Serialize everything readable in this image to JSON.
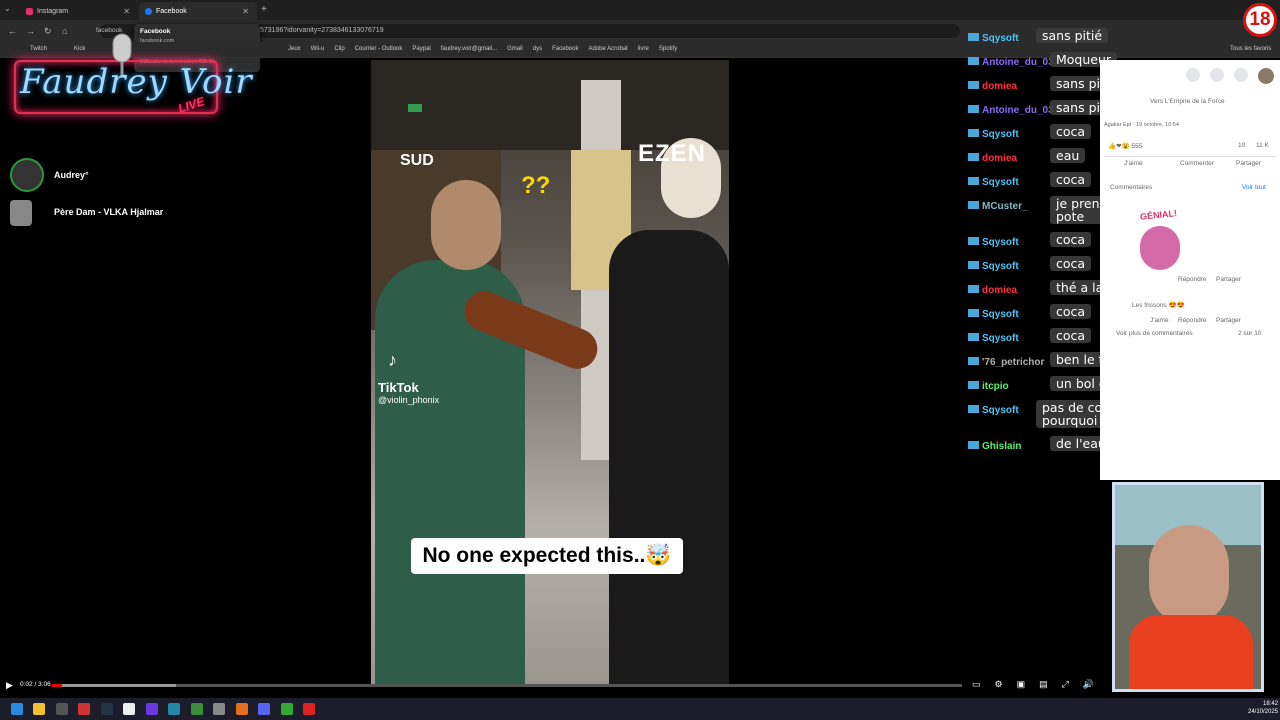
{
  "browser": {
    "tabs": [
      {
        "label": "Instagram"
      },
      {
        "label": "Facebook"
      }
    ],
    "tooltip_title": "Facebook",
    "tooltip_domain": "facebook.com",
    "tooltip_memory": "Utilisation de la mémoire : 731 Mo",
    "url_fragment": "facebook",
    "url": "573196?idorvanity=2738346133076719",
    "bookmarks": [
      "Twitch",
      "Kick",
      "Jeux",
      "Wii-u",
      "Clip",
      "Courrier - Outlook",
      "Paypal",
      "faudrey.voir@gmail...",
      "Gmail",
      "dys",
      "Facebook",
      "Adobe Acrobat",
      "livre",
      "Spotify"
    ],
    "all_bookmarks": "Tous les favoris"
  },
  "overlay": {
    "logo_text": "Faudrey Voir",
    "logo_live": "LIVE",
    "viewers": [
      {
        "name": "Audrey°"
      },
      {
        "name": "Père Dam - VLKA Hjalmar"
      }
    ],
    "badge": "18"
  },
  "video": {
    "caption": "No one expected this..🤯",
    "tiktok_brand": "TikTok",
    "tiktok_user": "@violin_phonix",
    "question_marks": "??",
    "store_sign": "EZEN",
    "store_sign2": "SUD",
    "time": "0:02 / 3:06",
    "progress": 0.011
  },
  "chat": [
    {
      "user": "Sqysoft",
      "color": "#4ec4f5",
      "msg": "sans pitié"
    },
    {
      "user": "Antoine_du_03",
      "color": "#8a6cf5",
      "msg": "Moqueur"
    },
    {
      "user": "domiea",
      "color": "#ff3040",
      "msg": "sans pitié"
    },
    {
      "user": "Antoine_du_03",
      "color": "#8a6cf5",
      "msg": "sans pitié"
    },
    {
      "user": "Sqysoft",
      "color": "#4ec4f5",
      "msg": "coca"
    },
    {
      "user": "domiea",
      "color": "#ff3040",
      "msg": "eau"
    },
    {
      "user": "Sqysoft",
      "color": "#4ec4f5",
      "msg": "coca"
    },
    {
      "user": "MCuster_",
      "color": "#7fb8c7",
      "msg": "je prends l'urine de mon\npote"
    },
    {
      "user": "Sqysoft",
      "color": "#4ec4f5",
      "msg": "coca"
    },
    {
      "user": "Sqysoft",
      "color": "#4ec4f5",
      "msg": "coca"
    },
    {
      "user": "domiea",
      "color": "#ff3040",
      "msg": "thé a la menthe"
    },
    {
      "user": "Sqysoft",
      "color": "#4ec4f5",
      "msg": "coca"
    },
    {
      "user": "Sqysoft",
      "color": "#4ec4f5",
      "msg": "coca"
    },
    {
      "user": "'76_petrichor",
      "color": "#b0b0b0",
      "msg": "ben le thé forcement"
    },
    {
      "user": "itcpio",
      "color": "#5af06a",
      "msg": "un bol de cyprine"
    },
    {
      "user": "Sqysoft",
      "color": "#4ec4f5",
      "msg": "pas de coca ? je comprend\npourquoi il s'est perdu"
    },
    {
      "user": "Ghislain",
      "color": "#5af06a",
      "msg": "de l'eau..."
    }
  ],
  "facebook": {
    "post_header": "Vers L'Empire de la Force",
    "post_meta": "Agakar Ept · 19 octobre, 10:54",
    "reactions": "555",
    "comments_count": "10",
    "views": "11 K",
    "like": "J'aime",
    "comment": "Commenter",
    "share": "Partager",
    "comments_title": "Commentaires",
    "see_all": "Voir tout",
    "sticker": "GÉNIAL!",
    "reply": "Répondre",
    "share2": "Partager",
    "comment2": "Les frissons 😍😍",
    "more_comments": "Voir plus de commentaires",
    "pager": "2 sur 10"
  },
  "clock": {
    "time": "18:42",
    "date": "24/10/2025"
  }
}
